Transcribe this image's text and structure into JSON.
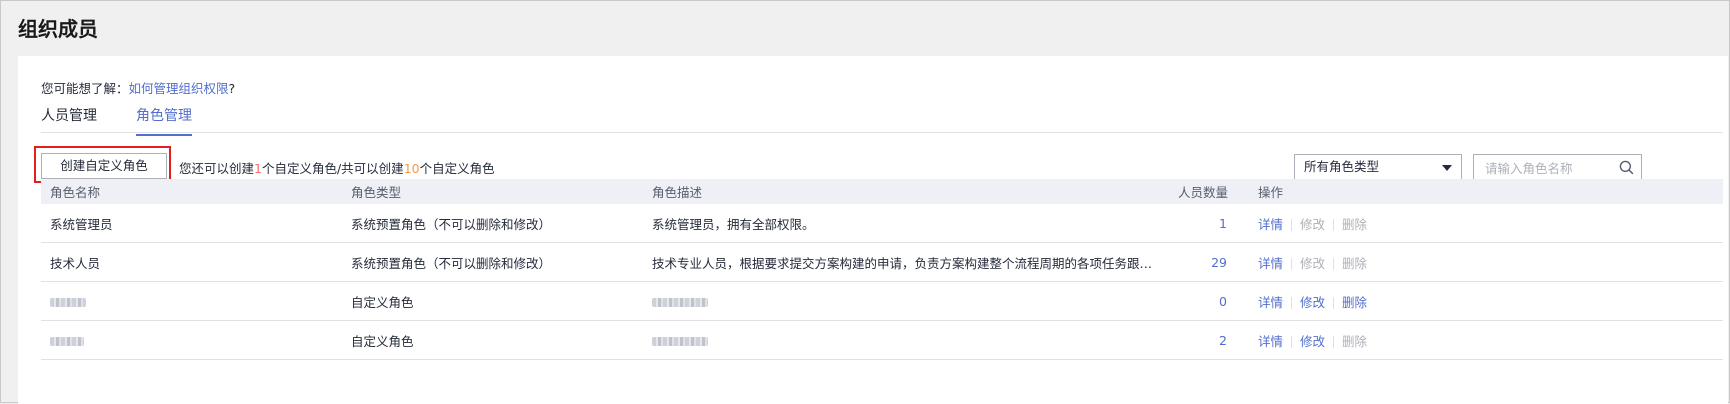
{
  "page": {
    "title": "组织成员",
    "hint_prefix": "您可能想了解：",
    "hint_link": "如何管理组织权限",
    "hint_suffix": "?"
  },
  "tabs": [
    {
      "label": "人员管理",
      "active": false
    },
    {
      "label": "角色管理",
      "active": true
    }
  ],
  "toolbar": {
    "create_button": "创建自定义角色",
    "quota_1": "您还可以创建",
    "quota_remaining": "1",
    "quota_2": "个自定义角色/共可以创建",
    "quota_total": "10",
    "quota_3": "个自定义角色",
    "filter_value": "所有角色类型",
    "search_placeholder": "请输入角色名称"
  },
  "table": {
    "headers": [
      "角色名称",
      "角色类型",
      "角色描述",
      "人员数量",
      "操作"
    ],
    "rows": [
      {
        "name": "系统管理员",
        "type": "系统预置角色（不可以删除和修改）",
        "desc": "系统管理员，拥有全部权限。",
        "count": "1",
        "name_blurred": false,
        "desc_blurred": false,
        "actions": [
          {
            "label": "详情",
            "enabled": true
          },
          {
            "label": "修改",
            "enabled": false
          },
          {
            "label": "删除",
            "enabled": false
          }
        ]
      },
      {
        "name": "技术人员",
        "type": "系统预置角色（不可以删除和修改）",
        "desc": "技术专业人员，根据要求提交方案构建的申请，负责方案构建整个流程周期的各项任务跟踪与处理，管理...",
        "count": "29",
        "name_blurred": false,
        "desc_blurred": false,
        "actions": [
          {
            "label": "详情",
            "enabled": true
          },
          {
            "label": "修改",
            "enabled": false
          },
          {
            "label": "删除",
            "enabled": false
          }
        ]
      },
      {
        "name": "",
        "type": "自定义角色",
        "desc": "",
        "count": "0",
        "name_blurred": true,
        "desc_blurred": true,
        "actions": [
          {
            "label": "详情",
            "enabled": true
          },
          {
            "label": "修改",
            "enabled": true
          },
          {
            "label": "删除",
            "enabled": true
          }
        ]
      },
      {
        "name": "",
        "type": "自定义角色",
        "desc": "",
        "count": "2",
        "name_blurred": true,
        "desc_blurred": true,
        "actions": [
          {
            "label": "详情",
            "enabled": true
          },
          {
            "label": "修改",
            "enabled": true
          },
          {
            "label": "删除",
            "enabled": false
          }
        ]
      }
    ]
  },
  "colors": {
    "link": "#526ecc",
    "highlight_box": "#e02020",
    "disabled": "#adb0b8",
    "header_bg": "#eef0f5"
  }
}
